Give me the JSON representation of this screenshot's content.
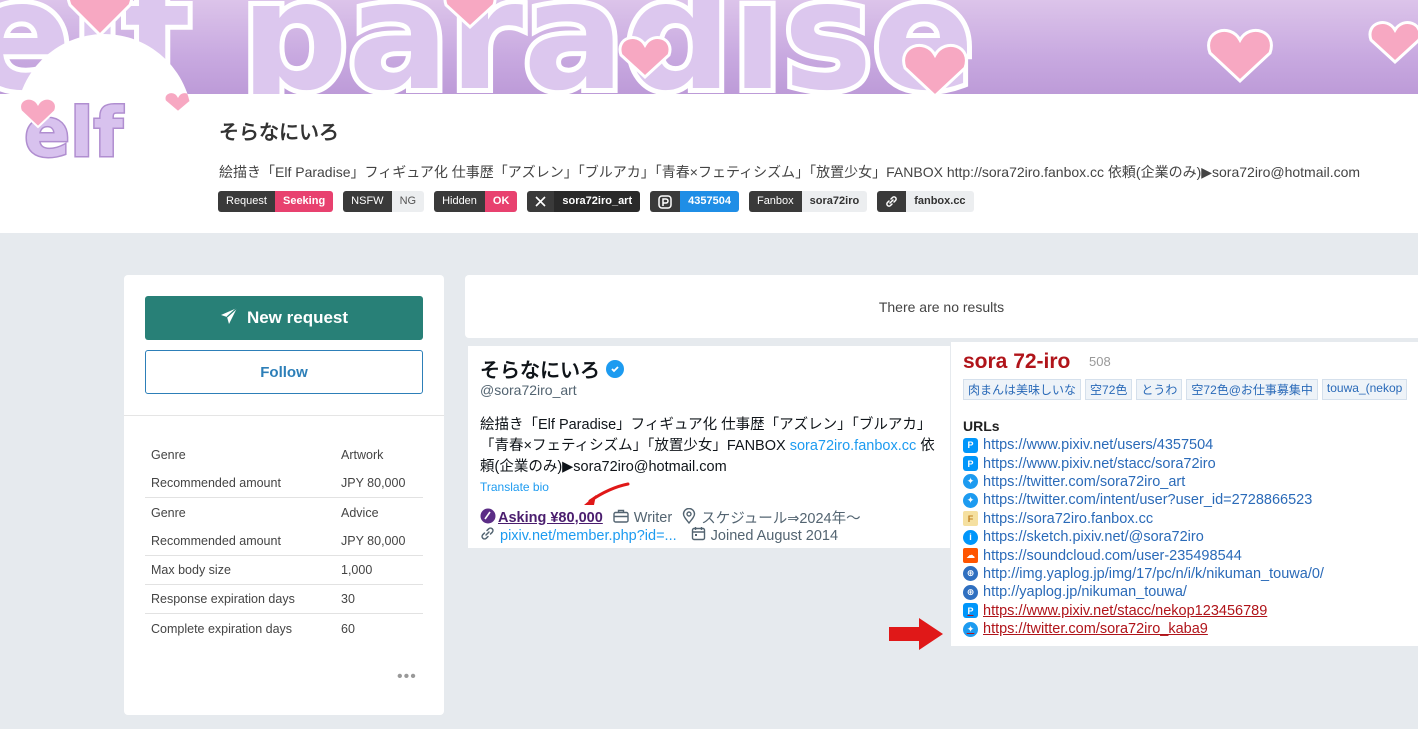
{
  "creator": {
    "name": "そらなにいろ",
    "bio": "絵描き「Elf Paradise」フィギュア化 仕事歴「アズレン」「ブルアカ」「青春×フェティシズム」「放置少女」FANBOX http://sora72iro.fanbox.cc 依頼(企業のみ)▶sora72iro@hotmail.com",
    "banner_text": "elf paradise",
    "avatar_text": "elf"
  },
  "badges": [
    {
      "key": "Request",
      "value": "Seeking",
      "style": "pink"
    },
    {
      "key": "NSFW",
      "value": "NG",
      "style": "light"
    },
    {
      "key": "Hidden",
      "value": "OK",
      "style": "pink"
    },
    {
      "key": "𝕏",
      "value": "sora72iro_art",
      "style": "dark",
      "icon": "x-icon"
    },
    {
      "key": "P",
      "value": "4357504",
      "style": "blue",
      "icon": "pixiv-icon"
    },
    {
      "key": "Fanbox",
      "value": "sora72iro",
      "style": "lightbold"
    },
    {
      "key": "link",
      "value": "fanbox.cc",
      "style": "lightbold",
      "icon": "link-icon"
    }
  ],
  "actions": {
    "new_request": "New request",
    "follow": "Follow"
  },
  "specs": [
    {
      "label": "Genre",
      "value": "Artwork"
    },
    {
      "label": "Recommended amount",
      "value": "JPY 80,000"
    },
    {
      "label": "Genre",
      "value": "Advice"
    },
    {
      "label": "Recommended amount",
      "value": "JPY 80,000"
    },
    {
      "label": "Max body size",
      "value": "1,000"
    },
    {
      "label": "Response expiration days",
      "value": "30"
    },
    {
      "label": "Complete expiration days",
      "value": "60"
    }
  ],
  "results": {
    "empty_text": "There are no results"
  },
  "twitter": {
    "name": "そらなにいろ",
    "handle": "@sora72iro_art",
    "bio_part1": "絵描き「Elf Paradise」フィギュア化 仕事歴「アズレン」「ブルアカ」「青春×フェティシズム」「放置少女」FANBOX ",
    "bio_link": "sora72iro.fanbox.cc",
    "bio_part2": " 依頼(企業のみ)▶sora72iro@hotmail.com",
    "translate": "Translate bio",
    "asking": "Asking ¥80,000",
    "category": "Writer",
    "location": "スケジュール⇒2024年〜",
    "website": "pixiv.net/member.php?id=...",
    "joined": "Joined August 2014"
  },
  "pixiv": {
    "name": "sora 72-iro",
    "count": "508",
    "tags": [
      "肉まんは美味しいな",
      "空72色",
      "とうわ",
      "空72色@お仕事募集中",
      "touwa_(nekop"
    ],
    "urls_label": "URLs",
    "urls": [
      {
        "text": "https://www.pixiv.net/users/4357504",
        "icon": "pixiv-icon",
        "dead": false
      },
      {
        "text": "https://www.pixiv.net/stacc/sora72iro",
        "icon": "pixiv-icon",
        "dead": false
      },
      {
        "text": "https://twitter.com/sora72iro_art",
        "icon": "twitter-icon",
        "dead": false
      },
      {
        "text": "https://twitter.com/intent/user?user_id=2728866523",
        "icon": "twitter-icon",
        "dead": false
      },
      {
        "text": "https://sora72iro.fanbox.cc",
        "icon": "fanbox-icon",
        "dead": false
      },
      {
        "text": "https://sketch.pixiv.net/@sora72iro",
        "icon": "sketch-icon",
        "dead": false
      },
      {
        "text": "https://soundcloud.com/user-235498544",
        "icon": "soundcloud-icon",
        "dead": false
      },
      {
        "text": "http://img.yaplog.jp/img/17/pc/n/i/k/nikuman_touwa/0/",
        "icon": "globe-icon",
        "dead": false
      },
      {
        "text": "http://yaplog.jp/nikuman_touwa/",
        "icon": "globe-icon",
        "dead": false
      },
      {
        "text": "https://www.pixiv.net/stacc/nekop123456789",
        "icon": "pixiv-icon",
        "dead": true
      },
      {
        "text": "https://twitter.com/sora72iro_kaba9",
        "icon": "twitter-icon",
        "dead": true
      }
    ]
  },
  "colors": {
    "primary": "#288077",
    "link": "#2d7fb8",
    "pink": "#e8416f",
    "annotation_red": "#e01818"
  }
}
